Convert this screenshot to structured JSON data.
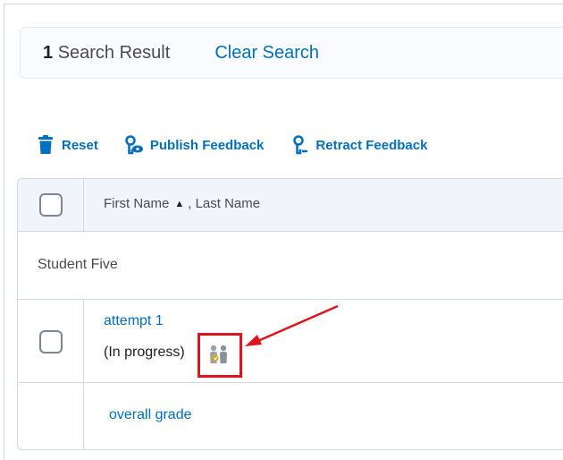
{
  "search": {
    "result_count": "1",
    "result_label": "Search Result",
    "clear_label": "Clear Search"
  },
  "toolbar": {
    "reset_label": "Reset",
    "publish_label": "Publish Feedback",
    "retract_label": "Retract Feedback"
  },
  "table": {
    "header": {
      "first_name": "First Name",
      "last_name": ", Last Name"
    },
    "student_name": "Student Five",
    "attempt_label": "attempt 1",
    "attempt_status": "(In progress)",
    "overall_label": "overall grade"
  },
  "icons": {
    "reset": "trash-icon",
    "publish": "publish-feedback-icon",
    "retract": "retract-feedback-icon",
    "sort": "sort-ascending-icon",
    "status": "users-in-progress-icon"
  },
  "colors": {
    "link": "#006fbf",
    "annotation": "#e0141e",
    "header_bg": "#f1f5fb"
  }
}
